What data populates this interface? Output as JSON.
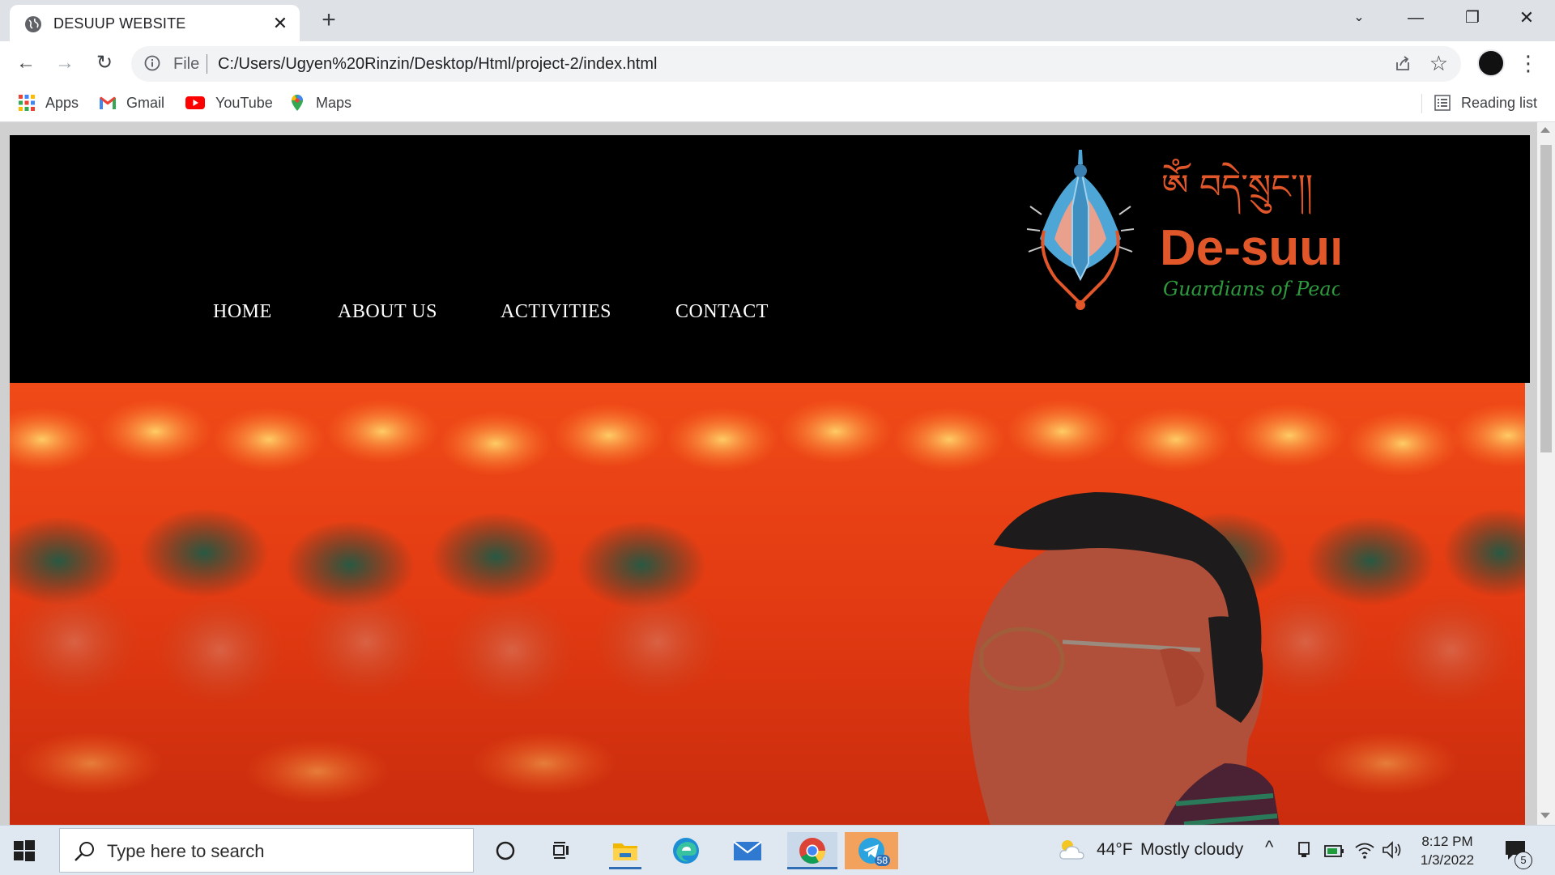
{
  "browser": {
    "tab_title": "DESUUP WEBSITE",
    "new_tab_symbol": "+",
    "address_prefix": "File",
    "url": "C:/Users/Ugyen%20Rinzin/Desktop/Html/project-2/index.html",
    "bookmarks": [
      "Apps",
      "Gmail",
      "YouTube",
      "Maps"
    ],
    "reading_list": "Reading list"
  },
  "site": {
    "nav": [
      "HOME",
      "ABOUT US",
      "ACTIVITIES",
      "CONTACT"
    ],
    "logo": {
      "script_text": "ༀ བདེ་སྲུང་།།",
      "name": "De-suung",
      "tagline": "Guardians of Peace"
    }
  },
  "taskbar": {
    "search_placeholder": "Type here to search",
    "weather_temp": "44°F",
    "weather_desc": "Mostly cloudy",
    "time": "8:12 PM",
    "date": "1/3/2022",
    "notification_count": "5",
    "telegram_badge": "58"
  },
  "colors": {
    "header_bg": "#000000",
    "logo_orange": "#e2572a",
    "logo_green": "#2e9a3e",
    "hero_red": "#e23a12"
  },
  "icons": [
    "globe-icon",
    "close-icon",
    "back-icon",
    "forward-icon",
    "reload-icon",
    "info-icon",
    "share-icon",
    "star-icon",
    "apps-icon",
    "gmail-icon",
    "youtube-icon",
    "maps-icon",
    "reading-list-icon",
    "windows-icon",
    "search-icon",
    "cortana-icon",
    "task-view-icon",
    "file-explorer-icon",
    "edge-icon",
    "mail-icon",
    "chrome-icon",
    "telegram-icon",
    "weather-icon",
    "notification-icon"
  ]
}
